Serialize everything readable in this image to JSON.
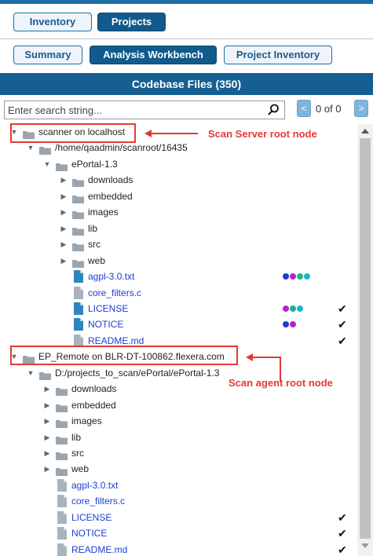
{
  "tabs_row1": [
    {
      "label": "Inventory",
      "active": false
    },
    {
      "label": "Projects",
      "active": true
    }
  ],
  "tabs_row2": [
    {
      "label": "Summary",
      "active": false
    },
    {
      "label": "Analysis Workbench",
      "active": true
    },
    {
      "label": "Project Inventory",
      "active": false
    }
  ],
  "header": {
    "title": "Codebase Files (350)"
  },
  "search": {
    "placeholder": "Enter search string...",
    "counter": "0 of 0",
    "prev": "<",
    "next": ">"
  },
  "tree": [
    {
      "type": "root",
      "label": "scanner on localhost",
      "expanded": true
    },
    {
      "type": "folder",
      "label": "/home/qaadmin/scanroot/16435",
      "expanded": true
    },
    {
      "type": "folder",
      "label": "ePortal-1.3",
      "expanded": true
    },
    {
      "type": "folder",
      "label": "downloads",
      "expanded": false
    },
    {
      "type": "folder",
      "label": "embedded",
      "expanded": false
    },
    {
      "type": "folder",
      "label": "images",
      "expanded": false
    },
    {
      "type": "folder",
      "label": "lib",
      "expanded": false
    },
    {
      "type": "folder",
      "label": "src",
      "expanded": false
    },
    {
      "type": "folder",
      "label": "web",
      "expanded": false
    },
    {
      "type": "file",
      "label": "agpl-3.0.txt",
      "dots": [
        "#1a3fd6",
        "#b426c8",
        "#18b78f",
        "#18b8c9"
      ],
      "check": false
    },
    {
      "type": "file",
      "label": "core_filters.c",
      "dots": [],
      "check": false
    },
    {
      "type": "file",
      "label": "LICENSE",
      "dots": [
        "#b426c8",
        "#18b78f",
        "#18b8c9"
      ],
      "check": true
    },
    {
      "type": "file",
      "label": "NOTICE",
      "dots": [
        "#1a3fd6",
        "#b426c8"
      ],
      "check": true
    },
    {
      "type": "file",
      "label": "README.md",
      "dots": [],
      "check": true
    },
    {
      "type": "root",
      "label": "EP_Remote on BLR-DT-100862.flexera.com",
      "expanded": true
    },
    {
      "type": "folder",
      "label": "D:/projects_to_scan/ePortal/ePortal-1.3",
      "expanded": true
    },
    {
      "type": "folder",
      "label": "downloads",
      "expanded": false
    },
    {
      "type": "folder",
      "label": "embedded",
      "expanded": false
    },
    {
      "type": "folder",
      "label": "images",
      "expanded": false
    },
    {
      "type": "folder",
      "label": "lib",
      "expanded": false
    },
    {
      "type": "folder",
      "label": "src",
      "expanded": false
    },
    {
      "type": "folder",
      "label": "web",
      "expanded": false
    },
    {
      "type": "file",
      "label": "agpl-3.0.txt",
      "dots": [],
      "check": false
    },
    {
      "type": "file",
      "label": "core_filters.c",
      "dots": [],
      "check": false
    },
    {
      "type": "file",
      "label": "LICENSE",
      "dots": [],
      "check": true
    },
    {
      "type": "file",
      "label": "NOTICE",
      "dots": [],
      "check": true
    },
    {
      "type": "file",
      "label": "README.md",
      "dots": [],
      "check": true
    }
  ],
  "annotations": {
    "server_label": "Scan Server root node",
    "agent_label": "Scan agent root node",
    "color": "#e53935"
  },
  "icons": {
    "search": "search-icon",
    "folder": "folder-icon",
    "file": "file-icon",
    "check": "checkmark-icon"
  }
}
